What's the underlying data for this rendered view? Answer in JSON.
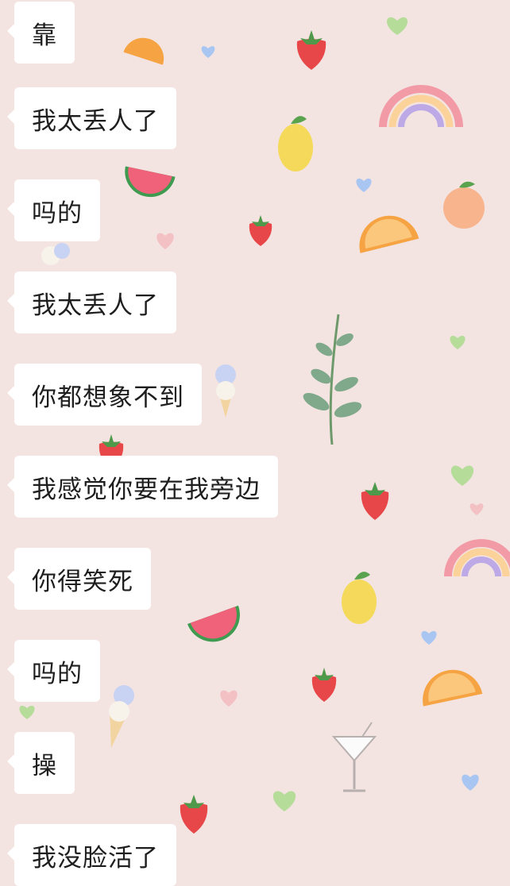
{
  "chat": {
    "messages": [
      {
        "text": "靠"
      },
      {
        "text": "我太丢人了"
      },
      {
        "text": "吗的"
      },
      {
        "text": "我太丢人了"
      },
      {
        "text": "你都想象不到"
      },
      {
        "text": "我感觉你要在我旁边"
      },
      {
        "text": "你得笑死"
      },
      {
        "text": "吗的"
      },
      {
        "text": "操"
      },
      {
        "text": "我没脸活了"
      }
    ]
  },
  "theme": {
    "background": "#f3e4e2",
    "bubble_color": "#ffffff",
    "text_color": "#1e1e1e"
  },
  "wallpaper": {
    "icons": [
      "strawberry-icon",
      "orange-slice-icon",
      "lemon-icon",
      "watermelon-icon",
      "heart-icon",
      "rainbow-icon",
      "ice-cream-icon",
      "leaf-branch-icon",
      "peach-icon",
      "cocktail-glass-icon"
    ]
  }
}
